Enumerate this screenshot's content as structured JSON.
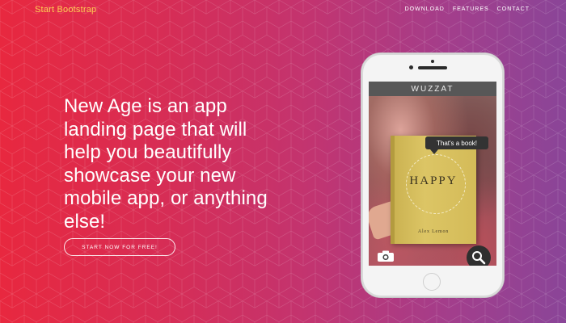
{
  "navbar": {
    "brand": "Start Bootstrap",
    "links": [
      {
        "label": "DOWNLOAD"
      },
      {
        "label": "FEATURES"
      },
      {
        "label": "CONTACT"
      }
    ],
    "brand_color": "#fdcc52"
  },
  "hero": {
    "headline_lines": [
      "New Age is an app",
      "landing page that will",
      "help you beautifully",
      "showcase your new",
      "mobile app, or anything",
      "else!"
    ],
    "cta_label": "START NOW FOR FREE!"
  },
  "phone": {
    "app_title": "WUZZAT",
    "bubble_text": "That's a book!",
    "book_title": "HAPPY",
    "book_author": "Alex Lemon",
    "icons": {
      "camera": "camera-icon",
      "search": "search-icon"
    }
  },
  "colors": {
    "gradient_start": "#e8283f",
    "gradient_end": "#8a4598",
    "accent": "#fdcc52"
  }
}
